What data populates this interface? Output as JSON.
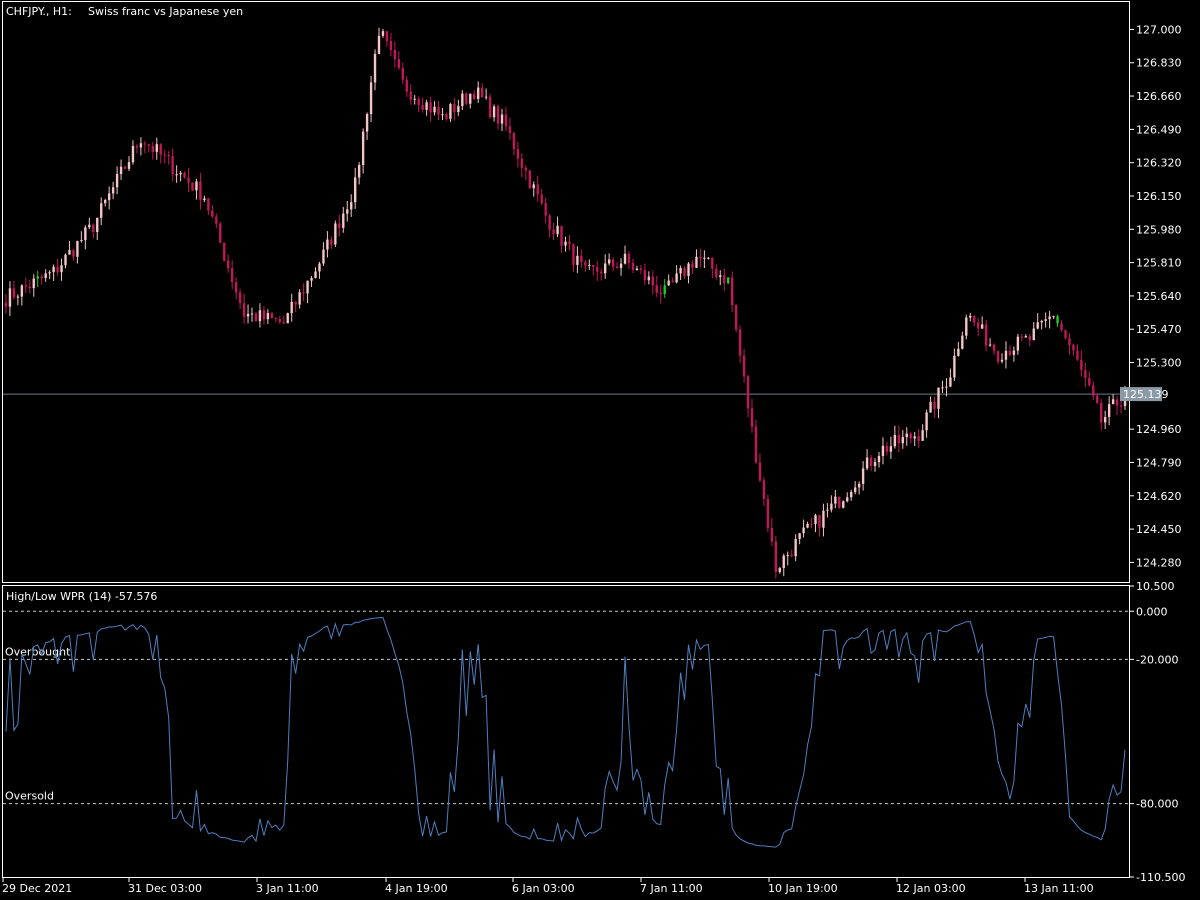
{
  "chart_title": {
    "symbol": "CHFJPY., H1:",
    "description": "Swiss franc vs Japanese yen"
  },
  "indicator_header": "High/Low WPR (14) -57.576",
  "colors": {
    "background": "#000000",
    "grid_border": "#ffffff",
    "bull_candle": "#f4c6c6",
    "bear_candle": "#c2185b",
    "green_candle": "#22cc22",
    "indicator_line": "#4f7fc0",
    "level_line": "#c8c8c8",
    "current_price_line": "#6c7d8c"
  },
  "current_price": "125.139",
  "x_axis_labels": [
    "29 Dec 2021",
    "31 Dec 03:00",
    "3 Jan 11:00",
    "4 Jan 19:00",
    "6 Jan 03:00",
    "7 Jan 11:00",
    "10 Jan 19:00",
    "12 Jan 03:00",
    "13 Jan 11:00"
  ],
  "chart_data": [
    {
      "type": "candlestick",
      "title": "CHFJPY., H1:  Swiss franc vs Japanese yen",
      "y_ticks": [
        "127.000",
        "126.830",
        "126.660",
        "126.490",
        "126.320",
        "126.150",
        "125.980",
        "125.810",
        "125.640",
        "125.470",
        "125.300",
        "124.960",
        "124.790",
        "124.620",
        "124.450",
        "124.280"
      ],
      "ylim": [
        124.18,
        127.14
      ],
      "current_price": 125.139,
      "trend_anchors": [
        {
          "bar": 0,
          "close": 125.63
        },
        {
          "bar": 12,
          "close": 125.76
        },
        {
          "bar": 22,
          "close": 126.0
        },
        {
          "bar": 34,
          "close": 126.45
        },
        {
          "bar": 50,
          "close": 126.15
        },
        {
          "bar": 60,
          "close": 125.55
        },
        {
          "bar": 70,
          "close": 125.5
        },
        {
          "bar": 80,
          "close": 125.85
        },
        {
          "bar": 88,
          "close": 126.2
        },
        {
          "bar": 94,
          "close": 127.0
        },
        {
          "bar": 100,
          "close": 126.72
        },
        {
          "bar": 110,
          "close": 126.55
        },
        {
          "bar": 118,
          "close": 126.69
        },
        {
          "bar": 126,
          "close": 126.5
        },
        {
          "bar": 136,
          "close": 126.05
        },
        {
          "bar": 146,
          "close": 125.75
        },
        {
          "bar": 156,
          "close": 125.82
        },
        {
          "bar": 166,
          "close": 125.65
        },
        {
          "bar": 174,
          "close": 125.84
        },
        {
          "bar": 182,
          "close": 125.72
        },
        {
          "bar": 188,
          "close": 124.95
        },
        {
          "bar": 194,
          "close": 124.25
        },
        {
          "bar": 200,
          "close": 124.4
        },
        {
          "bar": 210,
          "close": 124.6
        },
        {
          "bar": 220,
          "close": 124.85
        },
        {
          "bar": 230,
          "close": 124.94
        },
        {
          "bar": 238,
          "close": 125.25
        },
        {
          "bar": 242,
          "close": 125.55
        },
        {
          "bar": 250,
          "close": 125.35
        },
        {
          "bar": 258,
          "close": 125.42
        },
        {
          "bar": 264,
          "close": 125.55
        },
        {
          "bar": 270,
          "close": 125.3
        },
        {
          "bar": 276,
          "close": 125.0
        },
        {
          "bar": 282,
          "close": 125.139
        }
      ]
    },
    {
      "type": "line",
      "title": "High/Low WPR (14) -57.576",
      "y_ticks": [
        "10.500",
        "0.000",
        "-20.000",
        "-80.000",
        "-110.500"
      ],
      "ylim": [
        -110.5,
        10.5
      ],
      "levels": [
        {
          "name": "Overbought",
          "value": -20
        },
        {
          "name": "Oversold",
          "value": -80
        },
        {
          "name": "",
          "value": 0
        }
      ],
      "last_value": -57.576
    }
  ]
}
